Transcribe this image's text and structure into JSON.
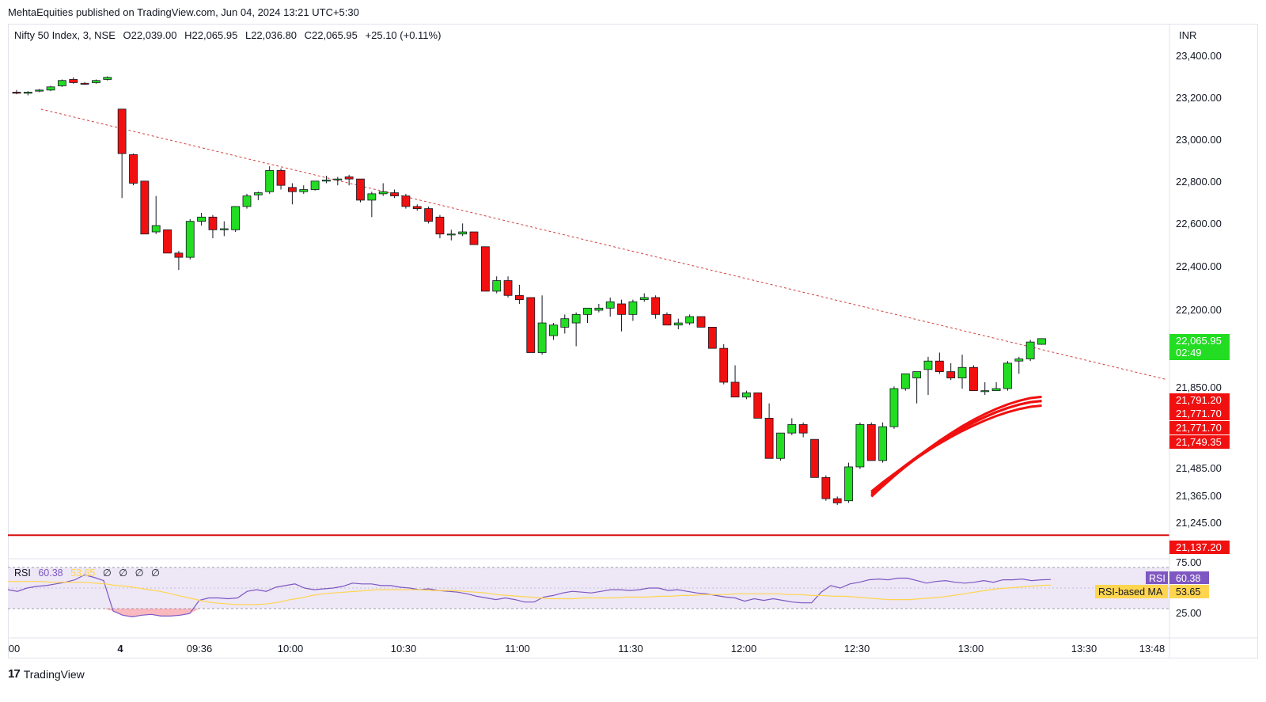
{
  "publisher_line": "MehtaEquities published on TradingView.com, Jun 04, 2024 13:21 UTC+5:30",
  "legend": {
    "symbol": "Nifty 50 Index, 3, NSE",
    "open": "O22,039.00",
    "high": "H22,065.95",
    "low": "L22,036.80",
    "close": "C22,065.95",
    "change": "+25.10 (+0.11%)"
  },
  "currency": "INR",
  "price_axis_ticks": [
    "23,400.00",
    "23,200.00",
    "23,000.00",
    "22,800.00",
    "22,600.00",
    "22,400.00",
    "22,200.00",
    "21,850.00",
    "21,485.00",
    "21,365.00",
    "21,245.00"
  ],
  "price_labels": [
    {
      "text": "22,065.95",
      "sub": "02:49",
      "color": "#22dd22"
    },
    {
      "text": "21,791.20",
      "color": "#f01010"
    },
    {
      "text": "21,771.70",
      "color": "#f01010"
    },
    {
      "text": "21,771.70",
      "color": "#f01010"
    },
    {
      "text": "21,749.35",
      "color": "#f01010"
    },
    {
      "text": "21,137.20",
      "color": "#f01010"
    }
  ],
  "time_axis_ticks": [
    "00",
    "4",
    "09:36",
    "10:00",
    "10:30",
    "11:00",
    "11:30",
    "12:00",
    "12:30",
    "13:00",
    "13:30",
    "13:48"
  ],
  "rsi": {
    "label": "RSI",
    "value": "60.38",
    "ma_value": "53.65",
    "na_values": [
      "∅",
      "∅",
      "∅",
      "∅"
    ],
    "axis_ticks": [
      "75.00",
      "25.00"
    ],
    "badge_rsi": "RSI",
    "badge_ma": "RSI-based MA",
    "colors": {
      "rsi": "#7e57c2",
      "ma": "#ffd54f",
      "band": "#ede7f6"
    }
  },
  "brand": "TradingView",
  "colors": {
    "up": "#22dd22",
    "down": "#f01010",
    "trendline": "#d04040",
    "support": "#d91010"
  },
  "chart_data": {
    "type": "candlestick",
    "title": "Nifty 50 Index, 3, NSE",
    "ylim": [
      21000,
      23520
    ],
    "support_level": 21137.2,
    "ribbon_last": [
      21791.2,
      21771.7,
      21771.7,
      21749.35
    ],
    "trendline": {
      "from": [
        2,
        23150
      ],
      "to": [
        100,
        21890
      ]
    },
    "candles": [
      [
        23230,
        23240,
        23220,
        23225
      ],
      [
        23225,
        23235,
        23215,
        23230
      ],
      [
        23235,
        23245,
        23230,
        23240
      ],
      [
        23240,
        23260,
        23235,
        23255
      ],
      [
        23260,
        23290,
        23255,
        23285
      ],
      [
        23290,
        23300,
        23270,
        23275
      ],
      [
        23272,
        23278,
        23265,
        23270
      ],
      [
        23275,
        23290,
        23270,
        23285
      ],
      [
        23290,
        23305,
        23285,
        23300
      ],
      [
        23150,
        23150,
        22730,
        22940
      ],
      [
        22935,
        22940,
        22790,
        22800
      ],
      [
        22810,
        22810,
        22560,
        22560
      ],
      [
        22570,
        22740,
        22560,
        22600
      ],
      [
        22580,
        22580,
        22470,
        22470
      ],
      [
        22470,
        22480,
        22390,
        22450
      ],
      [
        22450,
        22630,
        22440,
        22620
      ],
      [
        22620,
        22660,
        22600,
        22640
      ],
      [
        22640,
        22650,
        22540,
        22580
      ],
      [
        22580,
        22620,
        22550,
        22585
      ],
      [
        22580,
        22690,
        22570,
        22690
      ],
      [
        22690,
        22750,
        22680,
        22740
      ],
      [
        22745,
        22760,
        22720,
        22755
      ],
      [
        22760,
        22880,
        22750,
        22860
      ],
      [
        22860,
        22870,
        22770,
        22790
      ],
      [
        22780,
        22800,
        22700,
        22760
      ],
      [
        22760,
        22790,
        22750,
        22770
      ],
      [
        22770,
        22810,
        22765,
        22810
      ],
      [
        22810,
        22835,
        22800,
        22815
      ],
      [
        22820,
        22830,
        22790,
        22820
      ],
      [
        22830,
        22840,
        22790,
        22820
      ],
      [
        22820,
        22820,
        22710,
        22720
      ],
      [
        22720,
        22760,
        22640,
        22750
      ],
      [
        22750,
        22800,
        22740,
        22760
      ],
      [
        22755,
        22770,
        22730,
        22740
      ],
      [
        22740,
        22750,
        22680,
        22690
      ],
      [
        22690,
        22700,
        22670,
        22680
      ],
      [
        22680,
        22690,
        22610,
        22620
      ],
      [
        22640,
        22650,
        22540,
        22560
      ],
      [
        22560,
        22580,
        22530,
        22560
      ],
      [
        22560,
        22610,
        22550,
        22570
      ],
      [
        22570,
        22570,
        22510,
        22510
      ],
      [
        22500,
        22500,
        22290,
        22290
      ],
      [
        22290,
        22360,
        22280,
        22340
      ],
      [
        22340,
        22360,
        22260,
        22270
      ],
      [
        22270,
        22320,
        22230,
        22250
      ],
      [
        22260,
        22260,
        22000,
        22000
      ],
      [
        22000,
        22270,
        21990,
        22140
      ],
      [
        22080,
        22140,
        22060,
        22130
      ],
      [
        22120,
        22180,
        22090,
        22160
      ],
      [
        22140,
        22190,
        22030,
        22180
      ],
      [
        22180,
        22210,
        22140,
        22210
      ],
      [
        22200,
        22230,
        22190,
        22210
      ],
      [
        22210,
        22260,
        22170,
        22240
      ],
      [
        22230,
        22250,
        22100,
        22180
      ],
      [
        22180,
        22250,
        22150,
        22240
      ],
      [
        22250,
        22280,
        22240,
        22260
      ],
      [
        22260,
        22270,
        22160,
        22180
      ],
      [
        22180,
        22190,
        22130,
        22130
      ],
      [
        22130,
        22160,
        22110,
        22140
      ],
      [
        22140,
        22180,
        22130,
        22170
      ],
      [
        22170,
        22170,
        22120,
        22120
      ],
      [
        22120,
        22120,
        22020,
        22020
      ],
      [
        22020,
        22040,
        21850,
        21860
      ],
      [
        21860,
        21940,
        21790,
        21790
      ],
      [
        21790,
        21820,
        21780,
        21810
      ],
      [
        21810,
        21810,
        21690,
        21690
      ],
      [
        21690,
        21760,
        21500,
        21500
      ],
      [
        21500,
        21620,
        21490,
        21620
      ],
      [
        21620,
        21690,
        21610,
        21660
      ],
      [
        21660,
        21670,
        21600,
        21620
      ],
      [
        21590,
        21590,
        21410,
        21410
      ],
      [
        21410,
        21420,
        21300,
        21310
      ],
      [
        21310,
        21320,
        21280,
        21290
      ],
      [
        21300,
        21480,
        21290,
        21460
      ],
      [
        21460,
        21670,
        21450,
        21660
      ],
      [
        21660,
        21670,
        21490,
        21490
      ],
      [
        21490,
        21670,
        21480,
        21650
      ],
      [
        21650,
        21840,
        21640,
        21830
      ],
      [
        21830,
        21900,
        21820,
        21900
      ],
      [
        21880,
        21910,
        21760,
        21910
      ],
      [
        21920,
        21980,
        21800,
        21960
      ],
      [
        21960,
        22000,
        21900,
        21910
      ],
      [
        21910,
        21950,
        21870,
        21880
      ],
      [
        21880,
        21990,
        21830,
        21930
      ],
      [
        21930,
        21940,
        21820,
        21820
      ],
      [
        21820,
        21860,
        21800,
        21820
      ],
      [
        21820,
        21860,
        21820,
        21830
      ],
      [
        21830,
        21960,
        21820,
        21950
      ],
      [
        21960,
        21980,
        21900,
        21970
      ],
      [
        21970,
        22060,
        21960,
        22050
      ],
      [
        22039,
        22066,
        22037,
        22066
      ]
    ],
    "candle_gaps_after": [
      8
    ],
    "rsi_series": [
      48,
      46,
      50,
      52,
      53,
      55,
      57,
      60,
      66,
      63,
      59,
      22,
      17,
      15,
      17,
      18,
      16,
      16,
      17,
      19,
      35,
      38,
      38,
      37,
      38,
      46,
      48,
      46,
      51,
      53,
      55,
      50,
      48,
      49,
      50,
      52,
      56,
      55,
      55,
      53,
      53,
      51,
      50,
      48,
      49,
      47,
      46,
      45,
      43,
      40,
      38,
      36,
      38,
      36,
      33,
      33,
      39,
      41,
      44,
      46,
      45,
      44,
      46,
      48,
      48,
      47,
      48,
      50,
      50,
      47,
      48,
      46,
      44,
      43,
      41,
      39,
      38,
      34,
      37,
      35,
      37,
      35,
      33,
      32,
      32,
      45,
      53,
      50,
      55,
      57,
      60,
      61,
      60,
      62,
      62,
      59,
      56,
      58,
      59,
      57,
      56,
      57,
      59,
      57,
      60,
      60,
      61,
      59,
      60,
      60.38
    ],
    "rsi_ma_series": [
      58,
      58,
      58,
      58,
      57,
      57,
      57,
      57,
      56,
      55,
      53,
      52,
      50,
      48,
      46,
      43,
      40,
      37,
      34,
      32,
      31,
      30,
      30,
      30,
      31,
      33,
      36,
      38,
      41,
      43,
      44,
      45,
      46,
      47,
      48,
      48,
      48,
      48,
      48,
      47,
      47,
      47,
      46,
      45,
      44,
      42,
      41,
      40,
      39,
      38,
      37,
      37,
      37,
      38,
      38,
      38,
      38,
      39,
      39,
      39,
      40,
      40,
      41,
      41,
      42,
      42,
      42,
      43,
      43,
      43,
      43,
      43,
      42,
      42,
      41,
      41,
      40,
      40,
      39,
      38,
      37,
      36,
      36,
      36,
      37,
      38,
      39,
      41,
      43,
      45,
      47,
      49,
      50,
      51,
      52,
      53,
      53.65
    ]
  }
}
